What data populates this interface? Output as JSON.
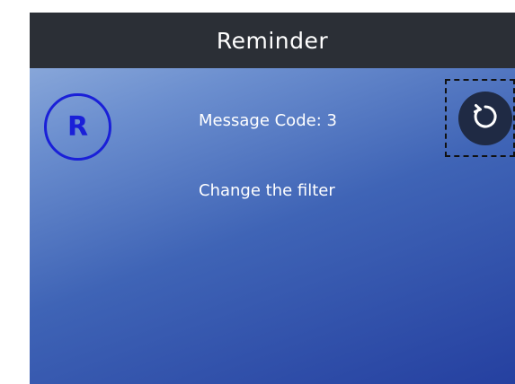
{
  "header": {
    "title": "Reminder"
  },
  "badge": {
    "letter": "R",
    "color": "#1a20d8"
  },
  "message": {
    "code_text": "Message Code: 3",
    "text": "Change the filter"
  },
  "controls": {
    "refresh_icon": "refresh-icon"
  },
  "colors": {
    "title_bar": "#2b2f36",
    "background_start": "#9ab6e0",
    "background_end": "#2540a0",
    "button_fill": "#1f2a44",
    "text": "#ffffff"
  }
}
